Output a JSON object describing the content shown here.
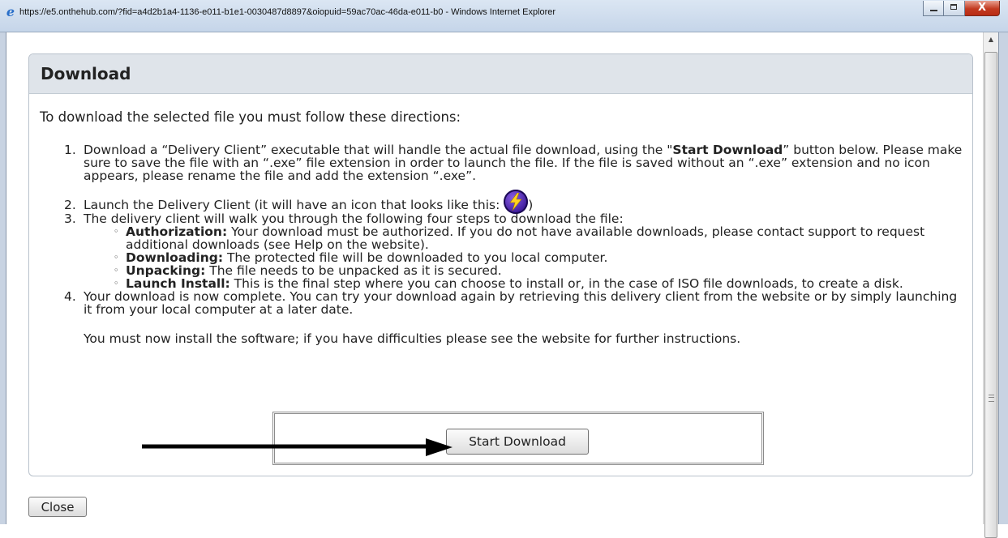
{
  "window": {
    "title": "https://e5.onthehub.com/?fid=a4d2b1a4-1136-e011-b1e1-0030487d8897&oiopuid=59ac70ac-46da-e011-b0 - Windows Internet Explorer",
    "icon": "ie-icon",
    "buttons": [
      "minimize",
      "maximize",
      "close"
    ]
  },
  "dialog": {
    "title": "Download",
    "intro": "To download the selected file you must follow these directions:",
    "steps": [
      {
        "number": "1.",
        "text_1": "Download a “Delivery Client” executable that will handle the actual file download, using the \"",
        "bold": "Start Download",
        "text_2": "” button below. Please make sure to save the file with an “.exe” file extension in order to launch the file. If the file is saved without an “.exe” extension and no icon appears, please rename the file and add the extension “.exe”."
      },
      {
        "number": "2.",
        "text_1": "Launch the Delivery Client (it will have an icon that looks like this: ",
        "icon": "delivery-client-lightning-icon",
        "text_2": ")"
      },
      {
        "number": "3.",
        "text": "The delivery client will walk you through the following four steps to download the file:",
        "substeps": [
          {
            "bullet": "◦",
            "bold": "Authorization:",
            "text": " Your download must be authorized. If you do not have available downloads, please contact support to request additional downloads (see Help on the website)."
          },
          {
            "bullet": "◦",
            "bold": "Downloading:",
            "text": " The protected file will be downloaded to you local computer."
          },
          {
            "bullet": "◦",
            "bold": "Unpacking:",
            "text": " The file needs to be unpacked as it is secured."
          },
          {
            "bullet": "◦",
            "bold": "Launch Install:",
            "text": " This is the final step where you can choose to install or, in the case of ISO file downloads, to create a disk."
          }
        ]
      },
      {
        "number": "4.",
        "text": "Your download is now complete. You can try your download again by retrieving this delivery client from the website or by simply launching it from your local computer at a later date.",
        "note": "You must now install the software; if you have difficulties please see the website for further instructions."
      }
    ],
    "start_button": "Start Download",
    "close_button": "Close"
  },
  "annotation": {
    "arrow": "arrow pointing to Start Download button"
  },
  "colors": {
    "header_bg": "#dfe4ea",
    "panel_border": "#b9c2cc",
    "close_red": "#c23a20",
    "icon_purple": "#3d1a99",
    "bolt_yellow": "#ffd21f"
  }
}
